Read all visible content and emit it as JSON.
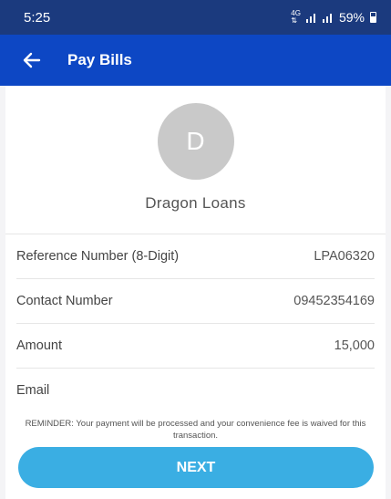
{
  "status_bar": {
    "time": "5:25",
    "network": "4G",
    "battery": "59%"
  },
  "app_bar": {
    "title": "Pay Bills",
    "back_icon": "arrow-left-icon"
  },
  "biller": {
    "initial": "D",
    "name": "Dragon Loans"
  },
  "form": {
    "rows": [
      {
        "label": "Reference Number (8-Digit)",
        "value": "LPA06320"
      },
      {
        "label": "Contact Number",
        "value": "09452354169"
      },
      {
        "label": "Amount",
        "value": "15,000"
      },
      {
        "label": "Email",
        "value": ""
      }
    ]
  },
  "reminder": "REMINDER: Your payment will be processed and your convenience fee is waived for this transaction.",
  "next_button": {
    "label": "NEXT"
  },
  "colors": {
    "status_bar": "#1b3a7e",
    "app_bar": "#0d47c4",
    "button": "#3aaee3",
    "avatar": "#c9c9c9"
  }
}
